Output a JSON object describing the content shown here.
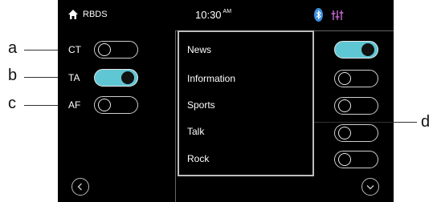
{
  "statusbar": {
    "app_name": "RBDS",
    "time": "10:30",
    "ampm": "AM",
    "icons": [
      "home-icon",
      "bluetooth-icon",
      "equalizer-icon"
    ],
    "accent_color": "#5fc6d4"
  },
  "settings": [
    {
      "label": "CT",
      "state": "off"
    },
    {
      "label": "TA",
      "state": "on"
    },
    {
      "label": "AF",
      "state": "off"
    }
  ],
  "genres": [
    {
      "label": "News",
      "state": "on"
    },
    {
      "label": "Information",
      "state": "off"
    },
    {
      "label": "Sports",
      "state": "off"
    },
    {
      "label": "Talk",
      "state": "off"
    },
    {
      "label": "Rock",
      "state": "off"
    }
  ],
  "navigation": {
    "back_icon": "chevron-left-icon",
    "scroll_icon": "chevron-down-icon"
  },
  "callouts": {
    "a": "a",
    "b": "b",
    "c": "c",
    "d": "d"
  }
}
